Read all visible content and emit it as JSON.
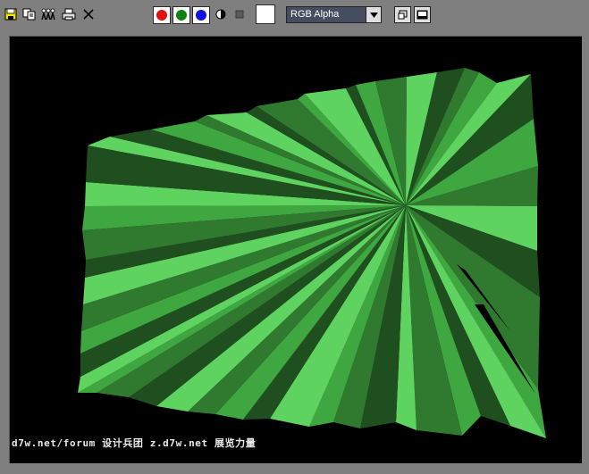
{
  "toolbar": {
    "buttons": [
      {
        "name": "save-image-icon"
      },
      {
        "name": "clone-window-icon"
      },
      {
        "name": "track-users-icon"
      },
      {
        "name": "print-icon"
      },
      {
        "name": "clear-icon"
      }
    ],
    "channels": [
      {
        "name": "red-channel-toggle",
        "color": "#e01010"
      },
      {
        "name": "green-channel-toggle",
        "color": "#108010"
      },
      {
        "name": "blue-channel-toggle",
        "color": "#1010e0"
      }
    ],
    "channel_display": {
      "value": "RGB Alpha"
    },
    "swatch_color": "#ffffff"
  },
  "render": {
    "background": "#000000",
    "watermark": "d7w.net/forum 设计兵团 z.d7w.net 展览力量"
  }
}
